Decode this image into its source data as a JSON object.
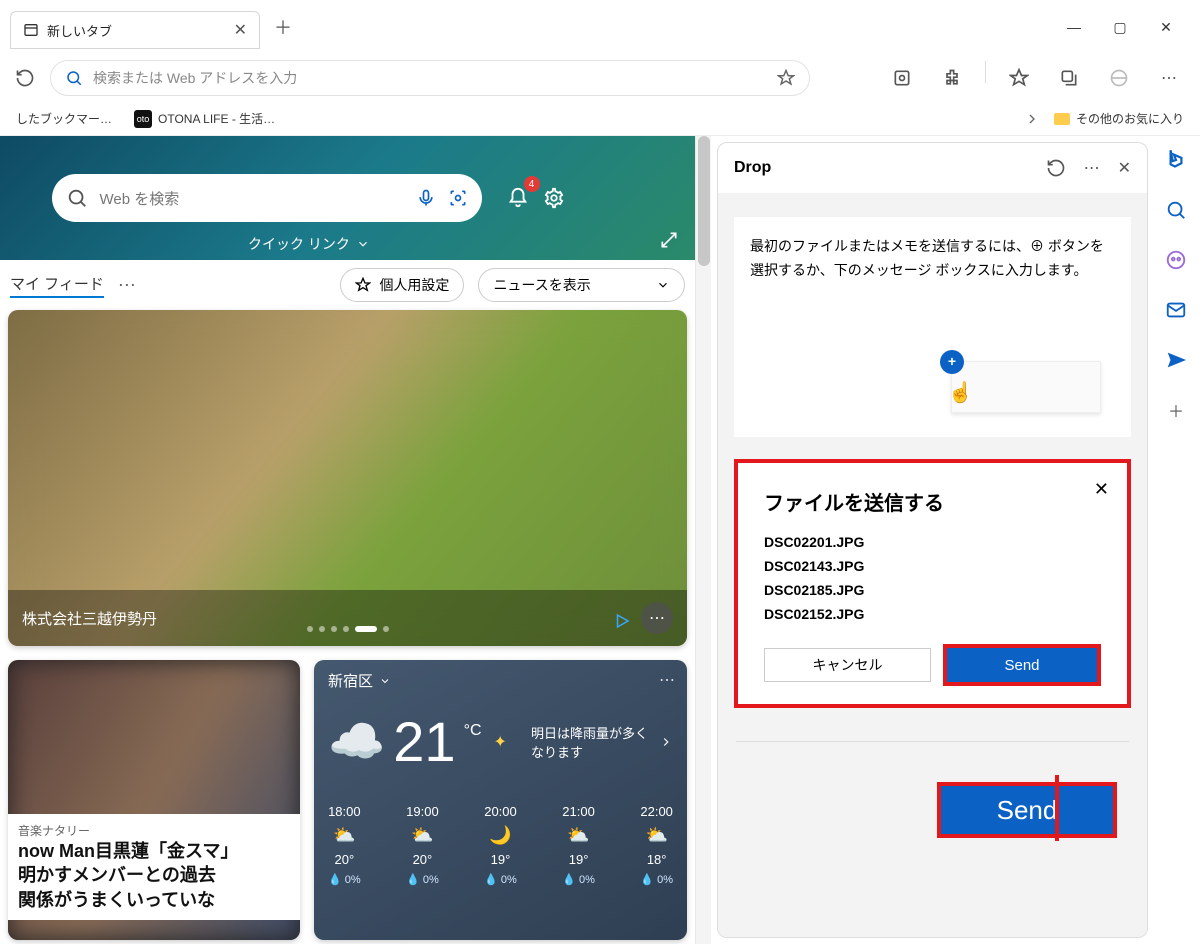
{
  "tab": {
    "title": "新しいタブ"
  },
  "omnibox": {
    "placeholder": "検索または Web アドレスを入力"
  },
  "bookmarks": {
    "truncated": "したブックマー…",
    "otona": "OTONA LIFE - 生活…",
    "other": "その他のお気に入り"
  },
  "hero": {
    "search_placeholder": "Web を検索",
    "quicklink": "クイック リンク",
    "badge": "4"
  },
  "feedbar": {
    "myfeed": "マイ フィード",
    "personalize": "個人用設定",
    "show_news": "ニュースを表示"
  },
  "bigcard": {
    "caption": "株式会社三越伊勢丹"
  },
  "news": {
    "source": "音楽ナタリー",
    "headline1": "now Man目黒蓮「金スマ」",
    "headline2": "明かすメンバーとの過去",
    "headline3": "関係がうまくいっていな"
  },
  "weather": {
    "location": "新宿区",
    "temp": "21",
    "unit": "°C",
    "msg": "明日は降雨量が多くなります",
    "forecast": [
      {
        "time": "18:00",
        "temp": "20°",
        "rain": "0%"
      },
      {
        "time": "19:00",
        "temp": "20°",
        "rain": "0%"
      },
      {
        "time": "20:00",
        "temp": "19°",
        "rain": "0%"
      },
      {
        "time": "21:00",
        "temp": "19°",
        "rain": "0%"
      },
      {
        "time": "22:00",
        "temp": "18°",
        "rain": "0%"
      }
    ]
  },
  "drop": {
    "title": "Drop",
    "info": "最初のファイルまたはメモを送信するには、⊕ ボタンを選択するか、下のメッセージ ボックスに入力します。",
    "send_title": "ファイルを送信する",
    "files": [
      "DSC02201.JPG",
      "DSC02143.JPG",
      "DSC02185.JPG",
      "DSC02152.JPG"
    ],
    "cancel": "キャンセル",
    "send": "Send",
    "big_send": "Send"
  }
}
